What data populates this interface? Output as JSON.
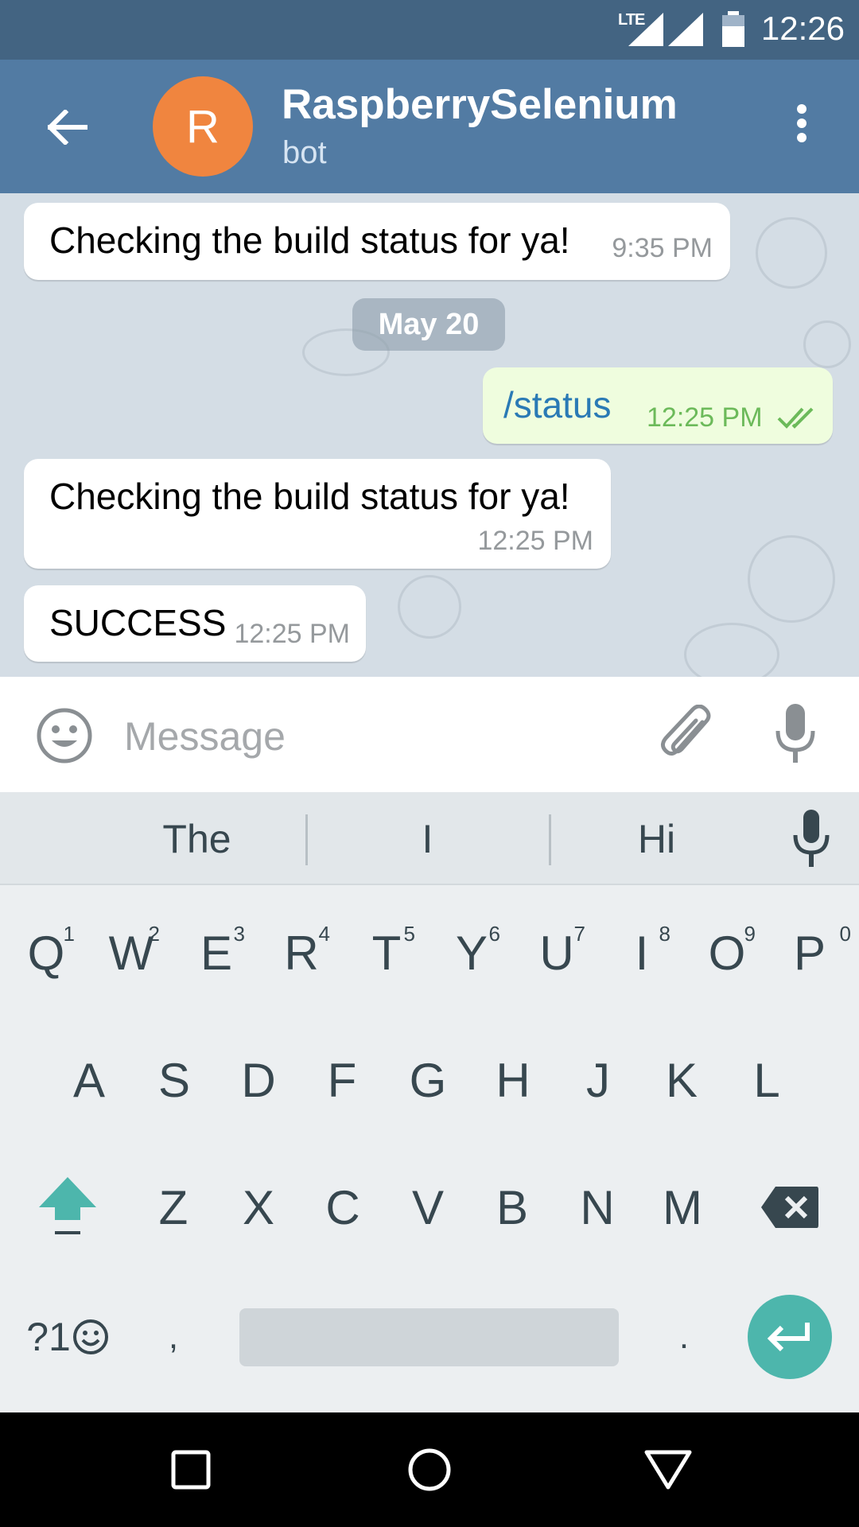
{
  "status_bar": {
    "network": "LTE",
    "time": "12:26"
  },
  "header": {
    "avatar_letter": "R",
    "title": "RaspberrySelenium",
    "subtitle": "bot"
  },
  "messages": [
    {
      "direction": "in",
      "text": "Checking the build status for ya!",
      "time": "9:35 PM"
    },
    {
      "direction": "out",
      "text": "/status",
      "time": "12:25 PM",
      "read": true
    },
    {
      "direction": "in",
      "text": "Checking the build status for ya!",
      "time": "12:25 PM"
    },
    {
      "direction": "in",
      "text": "SUCCESS",
      "time": "12:25 PM"
    }
  ],
  "date_divider": "May 20",
  "input": {
    "placeholder": "Message",
    "value": ""
  },
  "suggestions": [
    "The",
    "I",
    "Hi"
  ],
  "keyboard": {
    "row1": [
      "Q",
      "W",
      "E",
      "R",
      "T",
      "Y",
      "U",
      "I",
      "O",
      "P"
    ],
    "row1_hints": [
      "1",
      "2",
      "3",
      "4",
      "5",
      "6",
      "7",
      "8",
      "9",
      "0"
    ],
    "row2": [
      "A",
      "S",
      "D",
      "F",
      "G",
      "H",
      "J",
      "K",
      "L"
    ],
    "row3": [
      "Z",
      "X",
      "C",
      "V",
      "B",
      "N",
      "M"
    ],
    "symbols_label": "?1",
    "comma": ",",
    "period": "."
  },
  "colors": {
    "status_bar": "#436482",
    "header": "#527ba3",
    "avatar": "#f0853f",
    "outgoing_bubble": "#effdde",
    "accent_teal": "#4db6ac"
  },
  "icons": {
    "back": "arrow-left-icon",
    "menu": "more-vert-icon",
    "emoji": "smiley-icon",
    "attach": "paperclip-icon",
    "mic": "mic-icon",
    "shift": "shift-arrow-icon",
    "backspace": "backspace-icon",
    "enter": "enter-icon"
  }
}
